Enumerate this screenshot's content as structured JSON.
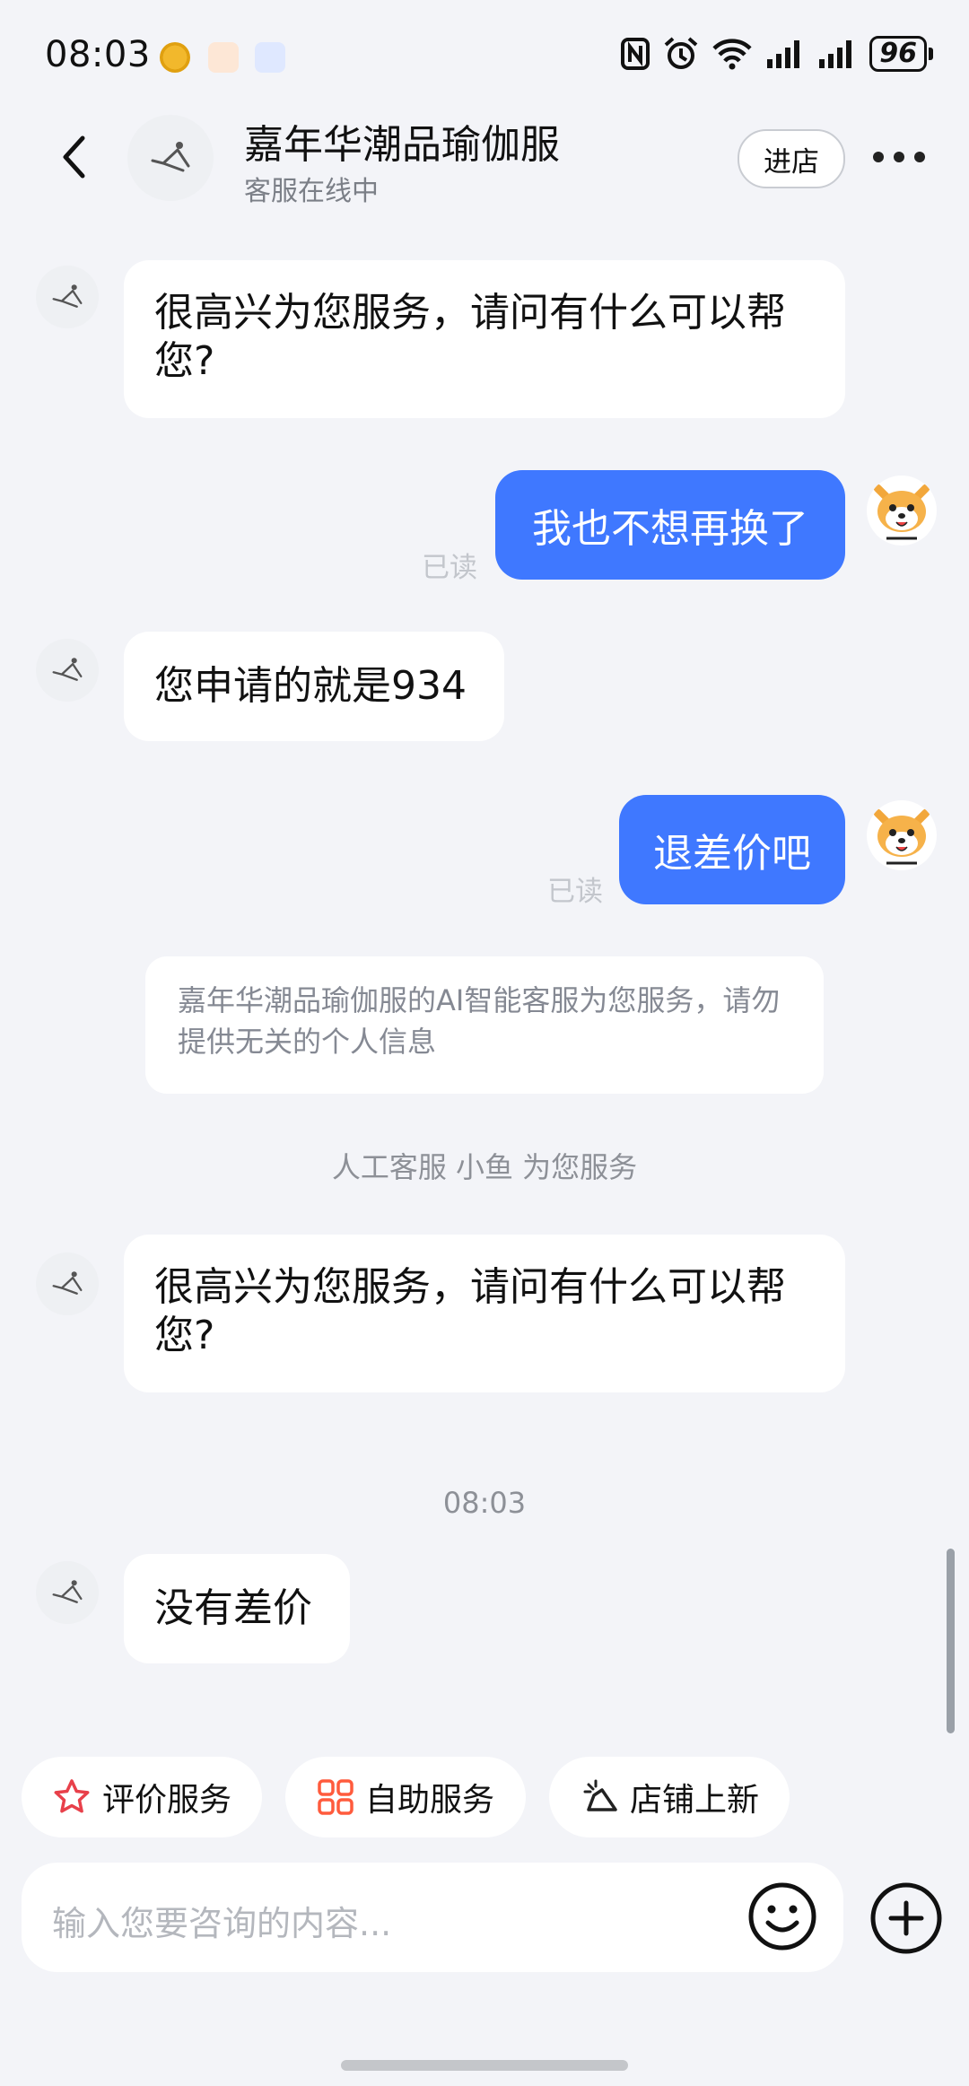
{
  "status_bar": {
    "time": "08:03",
    "battery": "96",
    "icons": [
      "nfc-icon",
      "alarm-icon",
      "wifi-icon",
      "signal-icon",
      "signal-icon"
    ]
  },
  "header": {
    "shop_name": "嘉年华潮品瑜伽服",
    "status": "客服在线中",
    "enter_store": "进店"
  },
  "messages": {
    "m1": "很高兴为您服务，请问有什么可以帮您?",
    "m2": "我也不想再换了",
    "m2_read": "已读",
    "m3": "您申请的就是934",
    "m4": "退差价吧",
    "m4_read": "已读",
    "notice": "嘉年华潮品瑜伽服的AI智能客服为您服务，请勿提供无关的个人信息",
    "handoff": "人工客服 小鱼 为您服务",
    "m5": "很高兴为您服务，请问有什么可以帮您?",
    "timestamp": "08:03",
    "m6": "没有差价"
  },
  "quick_actions": {
    "rate": "评价服务",
    "self_service": "自助服务",
    "new_arrivals": "店铺上新"
  },
  "input": {
    "placeholder": "输入您要咨询的内容..."
  },
  "colors": {
    "accent": "#3f78ff",
    "background": "#f3f4f8",
    "rate_icon": "#e8404a",
    "self_service_icon": "#ff5b3d"
  }
}
